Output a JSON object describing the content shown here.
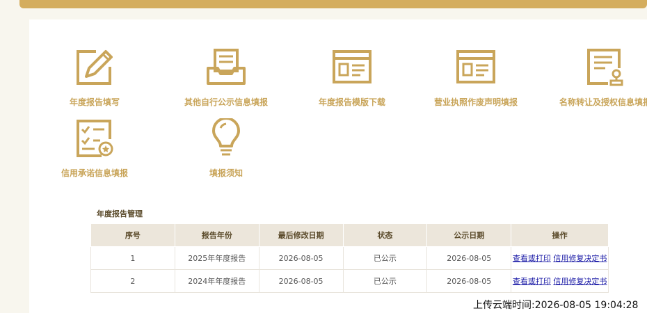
{
  "colors": {
    "accent": "#c9a55a",
    "topbar": "#d4ad5e",
    "header_bg": "#ece6db",
    "link": "#1a1aa6"
  },
  "tiles": [
    {
      "label": "年度报告填写",
      "icon": "pencil-square-icon"
    },
    {
      "label": "其他自行公示信息填报",
      "icon": "document-tray-icon"
    },
    {
      "label": "年度报告模版下载",
      "icon": "template-window-icon"
    },
    {
      "label": "营业执照作废声明填报",
      "icon": "license-window-icon"
    },
    {
      "label": "名称转让及授权信息填报",
      "icon": "certificate-stamp-icon"
    },
    {
      "label": "信用承诺信息填报",
      "icon": "checklist-badge-icon"
    },
    {
      "label": "填报须知",
      "icon": "lightbulb-icon"
    }
  ],
  "section_title": "年度报告管理",
  "table": {
    "headers": [
      "序号",
      "报告年份",
      "最后修改日期",
      "状态",
      "公示日期",
      "操作"
    ],
    "rows": [
      {
        "no": "1",
        "year": "2025年年度报告",
        "modified": "2026-08-05",
        "status": "已公示",
        "published": "2026-08-05",
        "action1": "查看或打印",
        "action2": "信用修复决定书"
      },
      {
        "no": "2",
        "year": "2024年年度报告",
        "modified": "2026-08-05",
        "status": "已公示",
        "published": "2026-08-05",
        "action1": "查看或打印",
        "action2": "信用修复决定书"
      }
    ]
  },
  "upload_time": "上传云端时间:2026-08-05 19:04:28"
}
